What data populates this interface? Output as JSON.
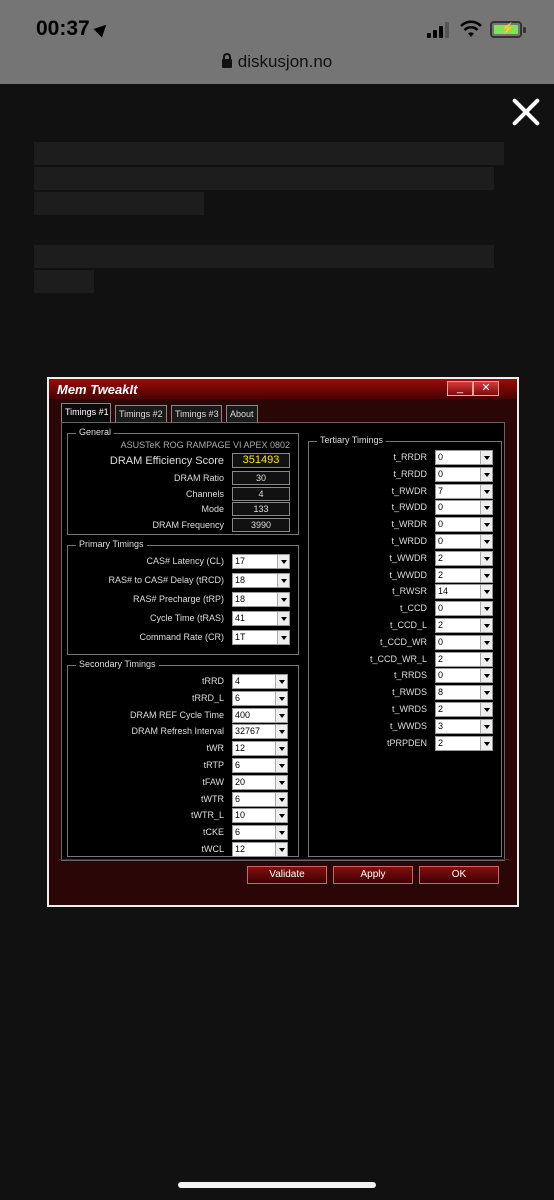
{
  "status": {
    "time": "00:37",
    "url": "diskusjon.no"
  },
  "window": {
    "title": "Mem TweakIt",
    "min_label": "_",
    "close_label": "✕",
    "tabs": [
      "Timings #1",
      "Timings #2",
      "Timings #3",
      "About"
    ],
    "general": {
      "label": "General",
      "board": "ASUSTeK ROG RAMPAGE VI APEX 0802",
      "score_label": "DRAM Efficiency Score",
      "score": "351493",
      "rows": [
        {
          "label": "DRAM Ratio",
          "value": "30"
        },
        {
          "label": "Channels",
          "value": "4"
        },
        {
          "label": "Mode",
          "value": "133"
        },
        {
          "label": "DRAM Frequency",
          "value": "3990"
        }
      ]
    },
    "primary": {
      "label": "Primary Timings",
      "rows": [
        {
          "label": "CAS# Latency (CL)",
          "value": "17"
        },
        {
          "label": "RAS# to CAS# Delay (tRCD)",
          "value": "18"
        },
        {
          "label": "RAS# Precharge (tRP)",
          "value": "18"
        },
        {
          "label": "Cycle Time (tRAS)",
          "value": "41"
        },
        {
          "label": "Command Rate (CR)",
          "value": "1T"
        }
      ]
    },
    "secondary": {
      "label": "Secondary Timings",
      "rows": [
        {
          "label": "tRRD",
          "value": "4"
        },
        {
          "label": "tRRD_L",
          "value": "6"
        },
        {
          "label": "DRAM REF Cycle Time",
          "value": "400"
        },
        {
          "label": "DRAM Refresh Interval",
          "value": "32767"
        },
        {
          "label": "tWR",
          "value": "12"
        },
        {
          "label": "tRTP",
          "value": "6"
        },
        {
          "label": "tFAW",
          "value": "20"
        },
        {
          "label": "tWTR",
          "value": "6"
        },
        {
          "label": "tWTR_L",
          "value": "10"
        },
        {
          "label": "tCKE",
          "value": "6"
        },
        {
          "label": "tWCL",
          "value": "12"
        }
      ]
    },
    "tertiary": {
      "label": "Tertiary Timings",
      "rows": [
        {
          "label": "t_RRDR",
          "value": "0"
        },
        {
          "label": "t_RRDD",
          "value": "0"
        },
        {
          "label": "t_RWDR",
          "value": "7"
        },
        {
          "label": "t_RWDD",
          "value": "0"
        },
        {
          "label": "t_WRDR",
          "value": "0"
        },
        {
          "label": "t_WRDD",
          "value": "0"
        },
        {
          "label": "t_WWDR",
          "value": "2"
        },
        {
          "label": "t_WWDD",
          "value": "2"
        },
        {
          "label": "t_RWSR",
          "value": "14"
        },
        {
          "label": "t_CCD",
          "value": "0"
        },
        {
          "label": "t_CCD_L",
          "value": "2"
        },
        {
          "label": "t_CCD_WR",
          "value": "0"
        },
        {
          "label": "t_CCD_WR_L",
          "value": "2"
        },
        {
          "label": "t_RRDS",
          "value": "0"
        },
        {
          "label": "t_RWDS",
          "value": "8"
        },
        {
          "label": "t_WRDS",
          "value": "2"
        },
        {
          "label": "t_WWDS",
          "value": "3"
        },
        {
          "label": "tPRPDEN",
          "value": "2"
        }
      ]
    },
    "buttons": {
      "validate": "Validate",
      "apply": "Apply",
      "ok": "OK"
    }
  }
}
